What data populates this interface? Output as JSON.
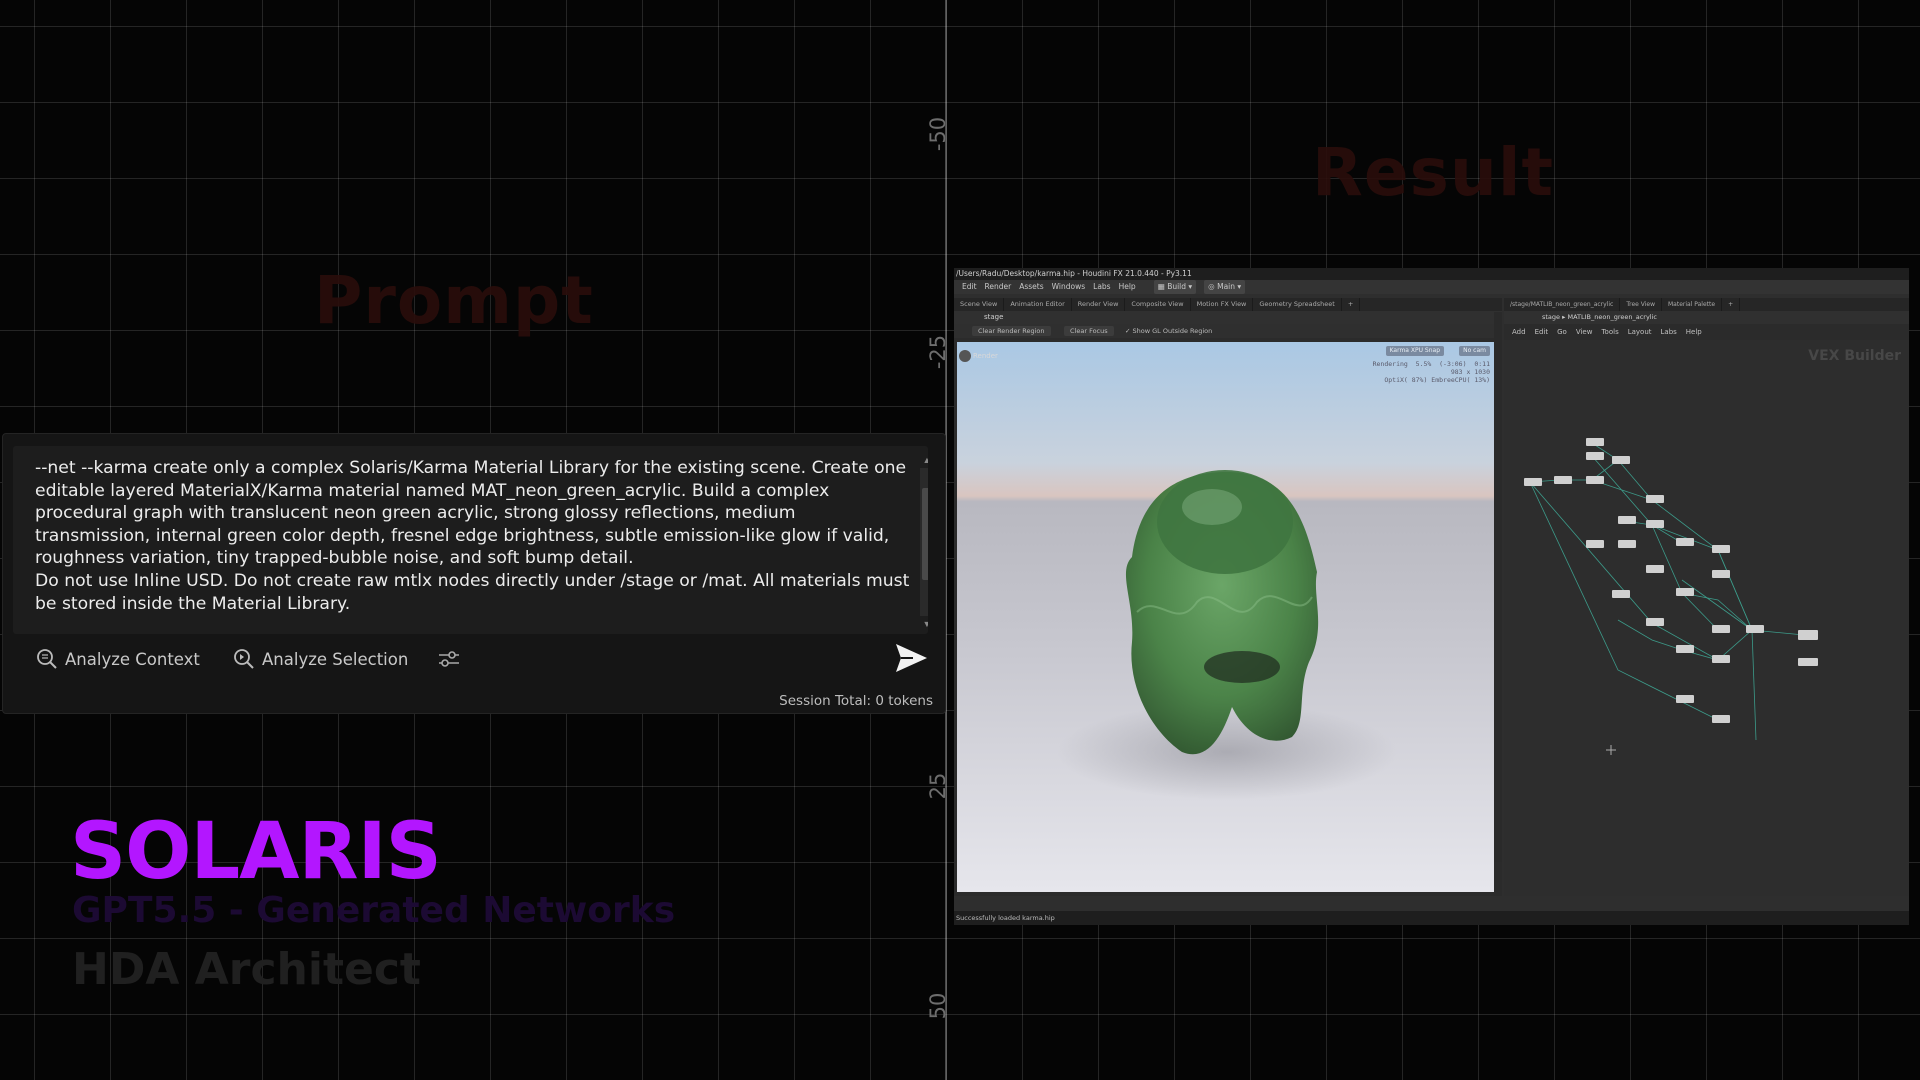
{
  "ruler": {
    "label_neg50": "-50",
    "label_neg25": "-25",
    "label_25": "25",
    "label_50": "50"
  },
  "ghost": {
    "result": "Result",
    "prompt": "Prompt"
  },
  "prompt_panel": {
    "text": "--net --karma create only a complex Solaris/Karma Material Library for the existing scene. Create one editable layered MaterialX/Karma material named MAT_neon_green_acrylic. Build a complex procedural graph with translucent neon green acrylic, strong glossy reflections, medium transmission, internal green color depth, fresnel edge brightness, subtle emission-like glow if valid, roughness variation, tiny trapped-bubble noise, and soft bump detail.\nDo not use Inline USD. Do not create raw mtlx nodes directly under /stage or /mat. All materials must be stored inside the Material Library.",
    "analyze_context": "Analyze Context",
    "analyze_selection": "Analyze Selection",
    "session_total": "Session Total: 0 tokens"
  },
  "branding": {
    "title": "SOLARIS",
    "subtitle": "GPT5.5 - Generated Networks",
    "tagline": "HDA Architect"
  },
  "houdini": {
    "window_title": "/Users/Radu/Desktop/karma.hip - Houdini FX 21.0.440 - Py3.11",
    "menu": [
      "Edit",
      "Render",
      "Assets",
      "Windows",
      "Labs",
      "Help"
    ],
    "desktop_dropdown": "Build",
    "context_dropdown": "Main",
    "left_tabs": [
      "Scene View",
      "Animation Editor",
      "Render View",
      "Composite View",
      "Motion FX View",
      "Geometry Spreadsheet"
    ],
    "left_path": "stage",
    "view_buttons": [
      "Clear Render Region",
      "Clear Focus",
      "Show GL Outside Region"
    ],
    "viewport_label": "Render",
    "renderer_badge": "Karma XPU Snap",
    "camera_badge": "No cam",
    "render_stats": "Rendering  5.5%  (-3:06)  0:11\n  983 x 1030\nOptiX( 87%) EmbreeCPU( 13%)",
    "right_tabs": [
      "/stage/MATLIB_neon_green_acrylic",
      "Tree View",
      "Material Palette"
    ],
    "right_path_root": "stage",
    "right_path_node": "MATLIB_neon_green_acrylic",
    "net_menu": [
      "Add",
      "Edit",
      "Go",
      "View",
      "Tools",
      "Layout",
      "Labs",
      "Help"
    ],
    "net_context_label": "VEX Builder",
    "status_text": "Successfully loaded karma.hip"
  },
  "colors": {
    "brand_purple": "#b316ff",
    "acrylic_green": "#3e8a3a",
    "background": "#050505"
  }
}
